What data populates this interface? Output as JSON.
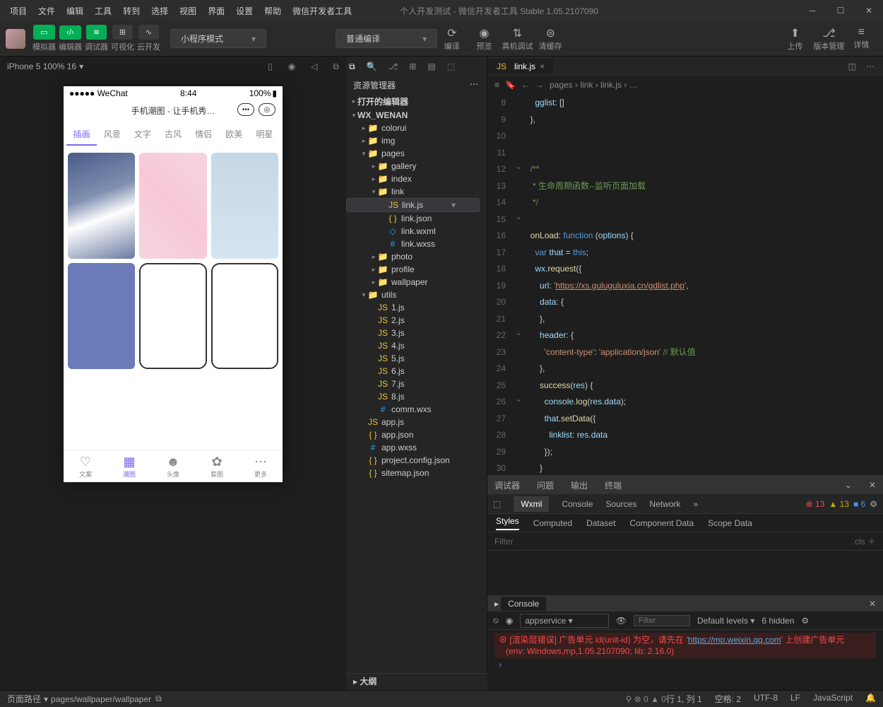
{
  "menu": [
    "项目",
    "文件",
    "编辑",
    "工具",
    "转到",
    "选择",
    "视图",
    "界面",
    "设置",
    "帮助",
    "微信开发者工具"
  ],
  "window_title": "个人开发测试 - 微信开发者工具 Stable 1.05.2107090",
  "toolbar": {
    "sim": "模拟器",
    "editor": "编辑器",
    "debugger": "调试器",
    "visual": "可视化",
    "cloud": "云开发",
    "mode": "小程序模式",
    "compile_mode": "普通编译",
    "compile": "编译",
    "preview": "预览",
    "real": "真机调试",
    "cache": "清缓存",
    "upload": "上传",
    "version": "版本管理",
    "detail": "详情"
  },
  "simbar": {
    "device": "iPhone 5 100% 16"
  },
  "phone": {
    "carrier": "●●●●● WeChat",
    "wifi": "📶",
    "time": "8:44",
    "battery": "100%",
    "title": "手机潮图 - 让手机秀…",
    "tabs": [
      "插画",
      "风景",
      "文字",
      "古风",
      "情侣",
      "欧美",
      "明星"
    ],
    "nav": [
      {
        "ic": "♡",
        "l": "文案"
      },
      {
        "ic": "▦",
        "l": "潮图"
      },
      {
        "ic": "☻",
        "l": "头像"
      },
      {
        "ic": "✿",
        "l": "套图"
      },
      {
        "ic": "⋯",
        "l": "更多"
      }
    ]
  },
  "explorer": {
    "title": "资源管理器",
    "open_editor": "打开的编辑器",
    "project": "WX_WENAN",
    "tree": [
      {
        "d": 1,
        "c": "▸",
        "t": "folder",
        "n": "colorui"
      },
      {
        "d": 1,
        "c": "▸",
        "t": "folder",
        "n": "img",
        "ic": "📷"
      },
      {
        "d": 1,
        "c": "▾",
        "t": "folder",
        "n": "pages",
        "ic": "📁"
      },
      {
        "d": 2,
        "c": "▸",
        "t": "folder",
        "n": "gallery"
      },
      {
        "d": 2,
        "c": "▸",
        "t": "folder",
        "n": "index"
      },
      {
        "d": 2,
        "c": "▾",
        "t": "folder",
        "n": "link"
      },
      {
        "d": 3,
        "c": "",
        "t": "js",
        "n": "link.js",
        "sel": true
      },
      {
        "d": 3,
        "c": "",
        "t": "json",
        "n": "link.json"
      },
      {
        "d": 3,
        "c": "",
        "t": "wxml",
        "n": "link.wxml"
      },
      {
        "d": 3,
        "c": "",
        "t": "wxss",
        "n": "link.wxss"
      },
      {
        "d": 2,
        "c": "▸",
        "t": "folder",
        "n": "photo"
      },
      {
        "d": 2,
        "c": "▸",
        "t": "folder",
        "n": "profile"
      },
      {
        "d": 2,
        "c": "▸",
        "t": "folder",
        "n": "wallpaper"
      },
      {
        "d": 1,
        "c": "▾",
        "t": "folder",
        "n": "utils",
        "ic": "📁"
      },
      {
        "d": 2,
        "c": "",
        "t": "js",
        "n": "1.js"
      },
      {
        "d": 2,
        "c": "",
        "t": "js",
        "n": "2.js"
      },
      {
        "d": 2,
        "c": "",
        "t": "js",
        "n": "3.js"
      },
      {
        "d": 2,
        "c": "",
        "t": "js",
        "n": "4.js"
      },
      {
        "d": 2,
        "c": "",
        "t": "js",
        "n": "5.js"
      },
      {
        "d": 2,
        "c": "",
        "t": "js",
        "n": "6.js"
      },
      {
        "d": 2,
        "c": "",
        "t": "js",
        "n": "7.js"
      },
      {
        "d": 2,
        "c": "",
        "t": "js",
        "n": "8.js"
      },
      {
        "d": 2,
        "c": "",
        "t": "wxss",
        "n": "comm.wxs"
      },
      {
        "d": 1,
        "c": "",
        "t": "js",
        "n": "app.js"
      },
      {
        "d": 1,
        "c": "",
        "t": "json",
        "n": "app.json"
      },
      {
        "d": 1,
        "c": "",
        "t": "wxss",
        "n": "app.wxss"
      },
      {
        "d": 1,
        "c": "",
        "t": "json",
        "n": "project.config.json"
      },
      {
        "d": 1,
        "c": "",
        "t": "json",
        "n": "sitemap.json"
      }
    ],
    "outline": "大纲"
  },
  "tab": {
    "name": "link.js"
  },
  "breadcrumb": [
    "pages",
    "link",
    "link.js",
    "…"
  ],
  "code_lines_start": 8,
  "dev": {
    "top": [
      "调试器",
      "问题",
      "输出",
      "终端"
    ],
    "tabs": [
      "Wxml",
      "Console",
      "Sources",
      "Network"
    ],
    "err_count": "13",
    "warn_count": "13",
    "info_count": "6",
    "style": [
      "Styles",
      "Computed",
      "Dataset",
      "Component Data",
      "Scope Data"
    ],
    "filter": "Filter",
    "cls": ".cls"
  },
  "console": {
    "title": "Console",
    "scope": "appservice",
    "filter": "Filter",
    "level": "Default levels",
    "hidden": "6 hidden",
    "err1": "[渲染层错误] 广告单元 id(unit-id) 为空，请先在 '",
    "link": "https://mp.weixin.qq.com",
    "err1b": "' 上创建广告单元",
    "env": "(env: Windows,mp,1.05.2107090; lib: 2.16.0)"
  },
  "status": {
    "path_label": "页面路径",
    "path": "pages/wallpaper/wallpaper",
    "err": "0",
    "warn": "0",
    "pos": "行 1, 列 1",
    "space": "空格: 2",
    "enc": "UTF-8",
    "eol": "LF",
    "lang": "JavaScript"
  }
}
